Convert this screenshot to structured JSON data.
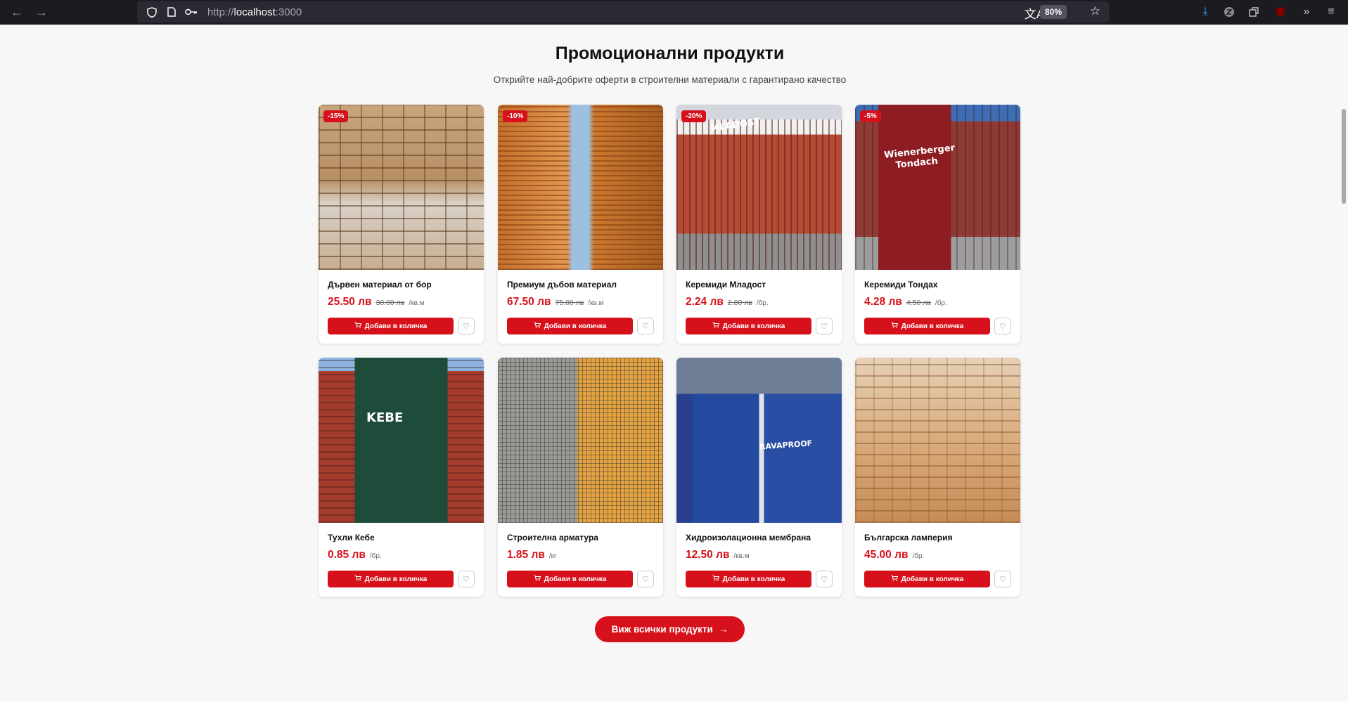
{
  "browser": {
    "url_prefix": "http://",
    "url_host": "localhost",
    "url_port": ":3000",
    "zoom": "80%"
  },
  "section": {
    "title": "Промоционални продукти",
    "subtitle": "Открийте най-добрите оферти в строителни материали с гарантирано качество"
  },
  "labels": {
    "add_to_cart": "Добави в количка",
    "view_all": "Виж всички продукти"
  },
  "products": [
    {
      "name": "Дървен материал от бор",
      "discount": "-15%",
      "price": "25.50 лв",
      "old_price": "30.00 лв",
      "unit": "/кв.м"
    },
    {
      "name": "Премиум дъбов материал",
      "discount": "-10%",
      "price": "67.50 лв",
      "old_price": "75.00 лв",
      "unit": "/кв.м"
    },
    {
      "name": "Керемиди Младост",
      "discount": "-20%",
      "price": "2.24 лв",
      "old_price": "2.80 лв",
      "unit": "/бр.",
      "img_text": "MLADOST"
    },
    {
      "name": "Керемиди Тондах",
      "discount": "-5%",
      "price": "4.28 лв",
      "old_price": "4.50 лв",
      "unit": "/бр.",
      "img_text": "Wienerberger Tondach"
    },
    {
      "name": "Тухли Кебе",
      "price": "0.85 лв",
      "unit": "/бр.",
      "img_text": "KEBE"
    },
    {
      "name": "Строителна арматура",
      "price": "1.85 лв",
      "unit": "/кг"
    },
    {
      "name": "Хидроизолационна мембрана",
      "price": "12.50 лв",
      "unit": "/кв.м",
      "img_text": "RAVAPROOF"
    },
    {
      "name": "Българска ламперия",
      "price": "45.00 лв",
      "unit": "/бр."
    }
  ]
}
